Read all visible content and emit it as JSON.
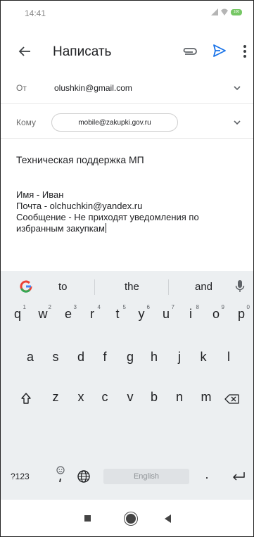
{
  "status_bar": {
    "time": "14:41",
    "battery": "100"
  },
  "app_bar": {
    "title": "Написать"
  },
  "from_row": {
    "label": "От",
    "value": "olushkin@gmail.com"
  },
  "to_row": {
    "label": "Кому",
    "chip": "mobile@zakupki.gov.ru"
  },
  "subject": "Техническая поддержка МП",
  "body_lines": [
    "Имя - Иван",
    "Почта - olchuchkin@yandex.ru",
    "Сообщение -  Не приходят уведомления по",
    "избранным закупкам"
  ],
  "keyboard": {
    "suggestions": [
      "to",
      "the",
      "and"
    ],
    "row1": [
      "q",
      "w",
      "e",
      "r",
      "t",
      "y",
      "u",
      "i",
      "o",
      "p"
    ],
    "row1_hints": [
      "1",
      "2",
      "3",
      "4",
      "5",
      "6",
      "7",
      "8",
      "9",
      "0"
    ],
    "row2": [
      "a",
      "s",
      "d",
      "f",
      "g",
      "h",
      "j",
      "k",
      "l"
    ],
    "row3": [
      "z",
      "x",
      "c",
      "v",
      "b",
      "n",
      "m"
    ],
    "symbols_key": "?123",
    "space_label": "English",
    "period_key": "."
  },
  "colors": {
    "send_accent": "#1a73e8",
    "keyboard_bg": "#eceff1"
  }
}
